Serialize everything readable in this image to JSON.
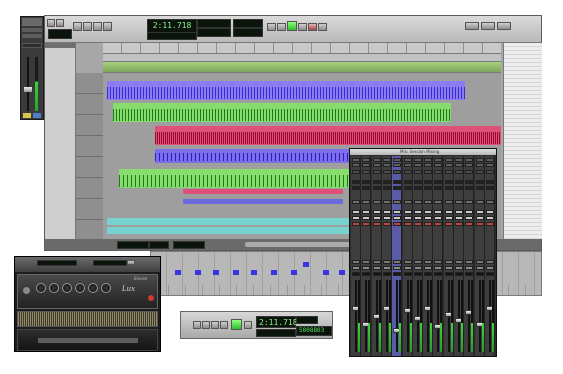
{
  "transport": {
    "main_counter": "2:11.718",
    "small_counter": "2:11.718",
    "samples_readout": "5808803"
  },
  "mixer_window": {
    "title": "Mix: Session Mixing"
  },
  "plugin": {
    "brand": "Eleven",
    "model": "Lux",
    "knob_count": 6
  },
  "colors": {
    "clip_purple": "#8a7df2",
    "clip_green": "#86dd6e",
    "clip_red": "#e0517a",
    "clip_cyan": "#78d3cf",
    "play_green": "#3cd43a",
    "mixer_selected": "#5a5aa8"
  },
  "icons": [
    "play-icon",
    "stop-icon",
    "rewind-icon",
    "fast-forward-icon",
    "record-icon",
    "loop-icon",
    "power-icon"
  ]
}
